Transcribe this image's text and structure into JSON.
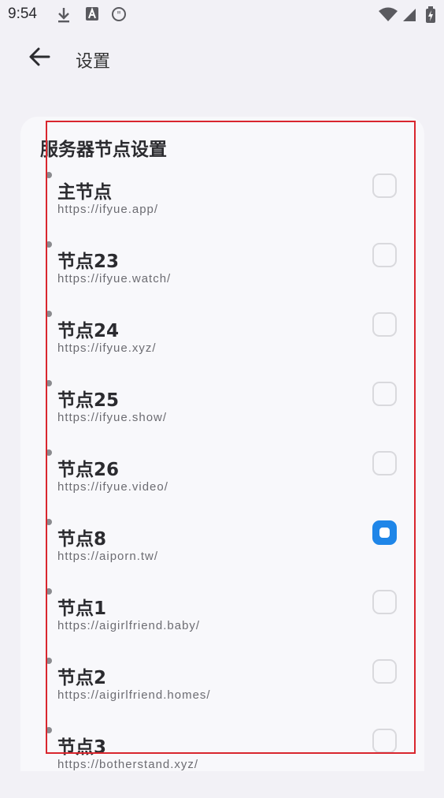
{
  "status_bar": {
    "time": "9:54",
    "left_icons": [
      "download-icon",
      "translate-icon",
      "quote-icon"
    ],
    "right_icons": [
      "wifi-icon",
      "signal-icon",
      "battery-charging-icon"
    ]
  },
  "app_bar": {
    "back_icon": "arrow-left-icon",
    "title": "设置"
  },
  "card": {
    "title": "服务器节点设置"
  },
  "accent_color": "#1f86e8",
  "highlight_color": "#d9262e",
  "nodes": [
    {
      "name": "主节点",
      "url": "https://ifyue.app/",
      "selected": false
    },
    {
      "name": "节点23",
      "url": "https://ifyue.watch/",
      "selected": false
    },
    {
      "name": "节点24",
      "url": "https://ifyue.xyz/",
      "selected": false
    },
    {
      "name": "节点25",
      "url": "https://ifyue.show/",
      "selected": false
    },
    {
      "name": "节点26",
      "url": "https://ifyue.video/",
      "selected": false
    },
    {
      "name": "节点8",
      "url": "https://aiporn.tw/",
      "selected": true
    },
    {
      "name": "节点1",
      "url": "https://aigirlfriend.baby/",
      "selected": false
    },
    {
      "name": "节点2",
      "url": "https://aigirlfriend.homes/",
      "selected": false
    },
    {
      "name": "节点3",
      "url": "https://botherstand.xyz/",
      "selected": false
    }
  ]
}
